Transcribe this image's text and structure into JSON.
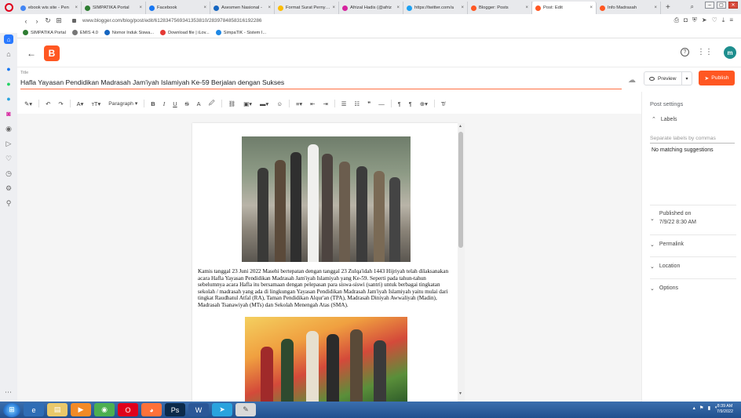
{
  "browser": {
    "tabs": [
      {
        "label": "ebook wis site - Pen",
        "color": "#4285f4",
        "active": false
      },
      {
        "label": "SIMPATIKA Portal",
        "color": "#2e7d32",
        "active": false
      },
      {
        "label": "Facebook",
        "color": "#1877f2",
        "active": false
      },
      {
        "label": "Asesmen Nasional -",
        "color": "#1565c0",
        "active": false
      },
      {
        "label": "Format Surat Pernyata",
        "color": "#fbbc04",
        "active": false
      },
      {
        "label": "Afrizal Hadis (@afriz",
        "color": "#d6249f",
        "active": false
      },
      {
        "label": "https://twitter.com/a",
        "color": "#1da1f2",
        "active": false
      },
      {
        "label": "Blogger: Posts",
        "color": "#ff5722",
        "active": false
      },
      {
        "label": "Post: Edit",
        "color": "#ff5722",
        "active": true
      },
      {
        "label": "Info Madrasah",
        "color": "#ff5722",
        "active": false
      }
    ],
    "new_tab": "+",
    "url": "www.blogger.com/blog/post/edit/6128347569341353810/2839784858316192286",
    "bookmarks": [
      {
        "label": "SIMPATIKA Portal",
        "color": "#2e7d32"
      },
      {
        "label": "EMIS 4.0",
        "color": "#777777"
      },
      {
        "label": "Nomor Induk Siswa...",
        "color": "#1565c0"
      },
      {
        "label": "Download file | iLov...",
        "color": "#e53935"
      },
      {
        "label": "SimpaTIK - Sistem I...",
        "color": "#1e88e5"
      }
    ]
  },
  "editor": {
    "title_label": "Title",
    "title": "Hafla Yayasan Pendidikan Madrasah Jam'iyah Islamiyah Ke-59 Berjalan dengan Sukses",
    "preview_label": "Preview",
    "publish_label": "Publish",
    "paragraph_style": "Paragraph",
    "body": "Kamis tanggal 23 Juni 2022 Masehi bertepatan dengan tanggal 23 Zulqa'idah 1443 Hijriyah telah dilaksanakan acara Hafla Yayasan Pendidikan Madrasah Jam'iyah Islamiyah yang Ke-59. Seperti pada tahun-tahun sebelumnya acara Hafla itu bersamaan dengan pelepasan para siswa-siswi (santri) untuk berbagai tingkatan sekolah / madrasah yang ada di lingkungan Yayasan Pendidikan Madrasah Jam'iyah Islamiyah yaitu mulai dari tingkat Raudhatul Atfal (RA), Taman Pendidikan Alqur'an (TPA), Madrasah Diniyah Awwaliyah (Madin), Madrasah Tsanawiyah (MTs) dan Sekolah Menengah Atas (SMA)."
  },
  "header": {
    "avatar_letter": "m"
  },
  "post_settings": {
    "title": "Post settings",
    "labels_heading": "Labels",
    "labels_placeholder": "Separate labels by commas",
    "no_match": "No matching suggestions",
    "published_label": "Published on",
    "published_value": "7/9/22 8:30 AM",
    "permalink": "Permalink",
    "location": "Location",
    "options": "Options"
  },
  "taskbar": {
    "time": "8:39 AM",
    "date": "7/9/2022"
  },
  "colors": {
    "accent": "#ff5722",
    "avatar": "#1e8e8e"
  }
}
